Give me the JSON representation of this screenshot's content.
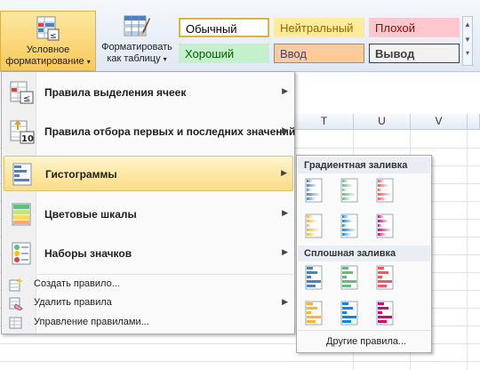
{
  "ribbon": {
    "conditional_formatting": {
      "line1": "Условное",
      "line2": "форматирование"
    },
    "format_as_table": {
      "line1": "Форматировать",
      "line2": "как таблицу"
    },
    "cell_styles": [
      {
        "label": "Обычный",
        "bg": "#ffffff",
        "border": "#e0b43c",
        "color": "#000000"
      },
      {
        "label": "Нейтральный",
        "bg": "#ffeb9c",
        "border": "#ffeb9c",
        "color": "#9c6500"
      },
      {
        "label": "Плохой",
        "bg": "#ffc7ce",
        "border": "#ffc7ce",
        "color": "#9c0006"
      },
      {
        "label": "Хороший",
        "bg": "#c6efce",
        "border": "#c6efce",
        "color": "#006100"
      },
      {
        "label": "Ввод",
        "bg": "#ffcc99",
        "border": "#8f8f8f",
        "color": "#3f3f76"
      },
      {
        "label": "Вывод",
        "bg": "#f2f2f2",
        "border": "#3f3f3f",
        "color": "#3f3f3f"
      }
    ]
  },
  "columns": [
    "T",
    "U",
    "V"
  ],
  "menu": {
    "items": [
      {
        "label": "Правила выделения ячеек",
        "icon": "highlight-cells-rules-icon"
      },
      {
        "label": "Правила отбора первых и последних значений",
        "icon": "top-bottom-rules-icon"
      },
      {
        "label": "Гистограммы",
        "icon": "data-bars-icon"
      },
      {
        "label": "Цветовые шкалы",
        "icon": "color-scales-icon"
      },
      {
        "label": "Наборы значков",
        "icon": "icon-sets-icon"
      }
    ],
    "small_items": [
      {
        "label": "Создать правило...",
        "icon": "new-rule-icon"
      },
      {
        "label": "Удалить правила",
        "icon": "clear-rules-icon"
      },
      {
        "label": "Управление правилами...",
        "icon": "manage-rules-icon"
      }
    ]
  },
  "submenu": {
    "gradient_header": "Градиентная заливка",
    "solid_header": "Сплошная заливка",
    "more_rules": "Другие правила...",
    "bar_colors": [
      "#4f81bd",
      "#63be7b",
      "#ff555a",
      "#ffb628",
      "#008aef",
      "#d6007b"
    ]
  }
}
